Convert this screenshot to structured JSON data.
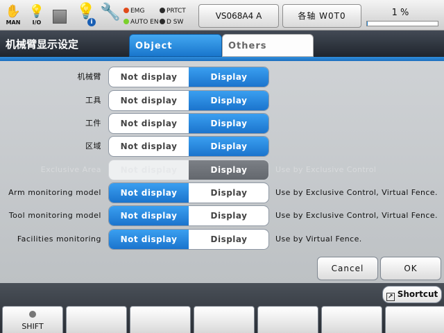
{
  "status_bar": {
    "mode_icon": {
      "icon": "hand-icon",
      "caption": "MAN"
    },
    "io_icon": {
      "icon": "lightbulb-icon",
      "caption": "I/O"
    },
    "stop_icon": {
      "icon": "stop-square-icon"
    },
    "info_icon": {
      "icon": "lightbulb-info-icon",
      "badge": "i"
    },
    "tool_icon": {
      "icon": "wrench-icon"
    },
    "leds": [
      {
        "label": "EMG",
        "color": "#e04a1a"
      },
      {
        "label": "PRTCT",
        "color": "#2b2b2b"
      },
      {
        "label": "AUTO EN",
        "color": "#7ad02a"
      },
      {
        "label": "D SW",
        "color": "#2b2b2b"
      }
    ],
    "robot_button": "VS068A4 A",
    "axes_button": "各轴 W0T0",
    "speed": {
      "label": "1 %",
      "value": 1
    }
  },
  "header": {
    "title": "机械臂显示设定",
    "tabs": [
      {
        "label": "Object",
        "active": true
      },
      {
        "label": "Others",
        "active": false
      }
    ]
  },
  "options": {
    "not_display": "Not display",
    "display": "Display"
  },
  "rows": [
    {
      "label": "机械臂",
      "selected": "Display",
      "note": "",
      "enabled": true
    },
    {
      "label": "工具",
      "selected": "Display",
      "note": "",
      "enabled": true
    },
    {
      "label": "工件",
      "selected": "Display",
      "note": "",
      "enabled": true
    },
    {
      "label": "区域",
      "selected": "Display",
      "note": "",
      "enabled": true
    },
    {
      "label": "Exclusive Area",
      "selected": "Display",
      "note": "Use by Exclusive Control",
      "enabled": false
    },
    {
      "label": "Arm monitoring model",
      "selected": "Not display",
      "note": "Use by Exclusive Control, Virtual Fence.",
      "enabled": true
    },
    {
      "label": "Tool monitoring model",
      "selected": "Not display",
      "note": "Use by Exclusive Control, Virtual Fence.",
      "enabled": true
    },
    {
      "label": "Facilities monitoring",
      "selected": "Not display",
      "note": "Use by Virtual Fence.",
      "enabled": true
    }
  ],
  "dialog": {
    "cancel_label": "Cancel",
    "ok_label": "OK"
  },
  "bottom_bar": {
    "shortcut_label": "Shortcut",
    "shift_label": "SHIFT",
    "function_keys": [
      "",
      "",
      "",
      "",
      "",
      ""
    ]
  },
  "colors": {
    "accent_blue": "#1b74cd",
    "header_dark": "#1f252d"
  }
}
